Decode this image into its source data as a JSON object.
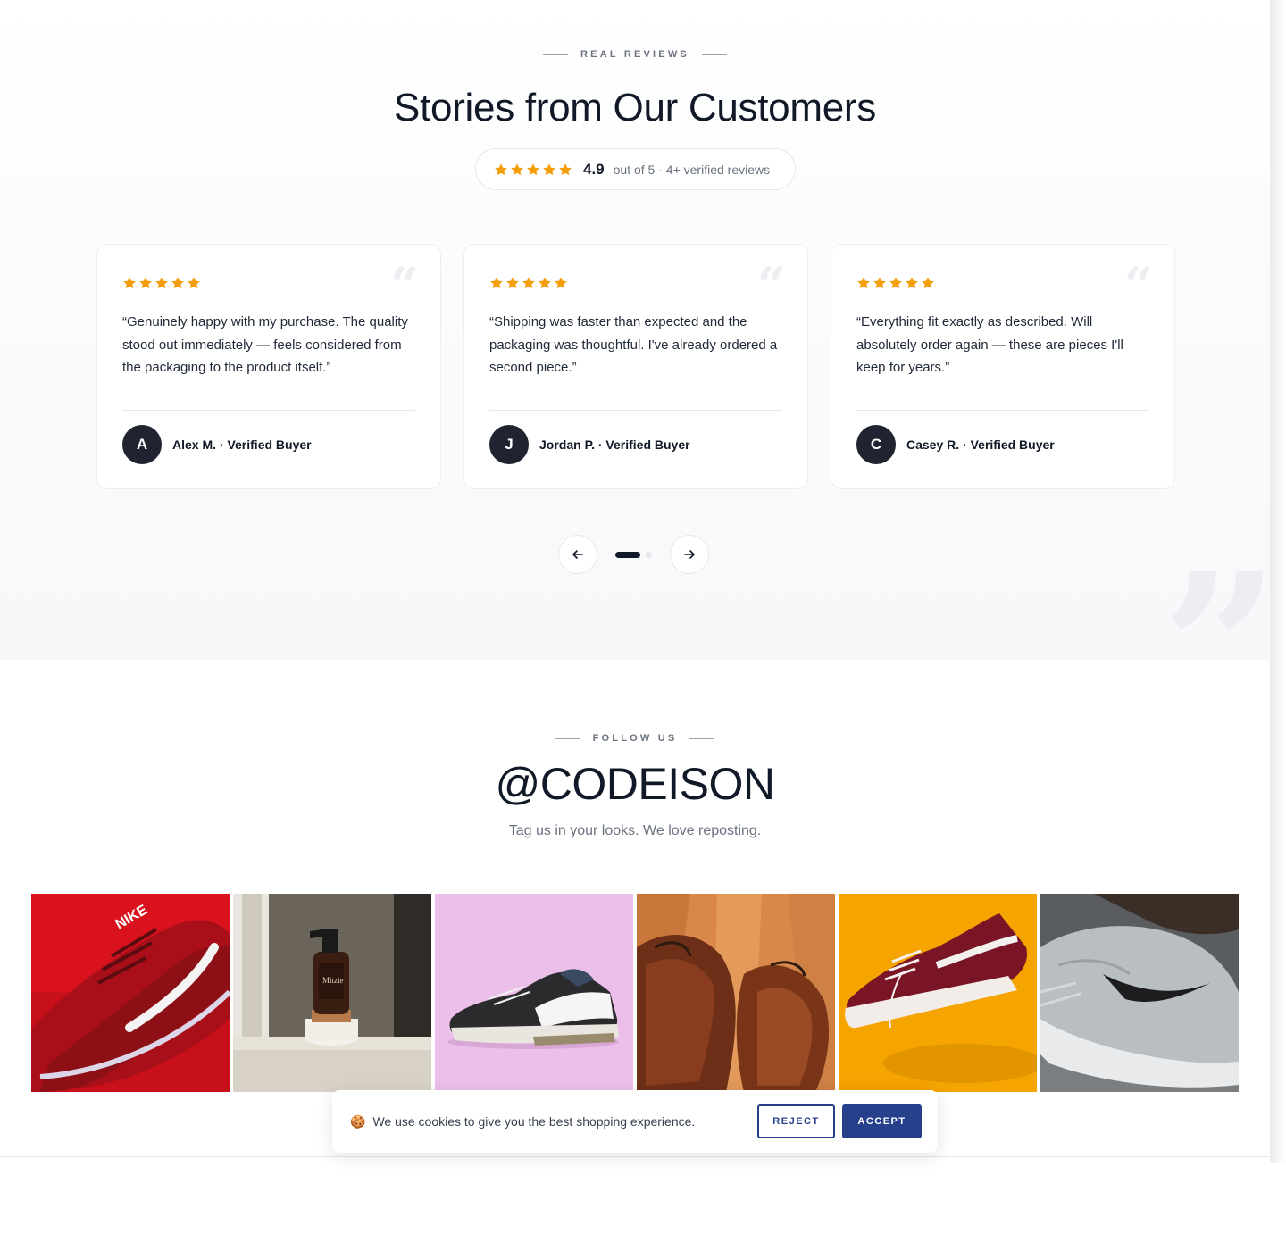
{
  "colors": {
    "star": "#f59e0b",
    "dark": "#111827",
    "avatar_bg": "#1f2430",
    "accent_button": "#27408b"
  },
  "reviews_section": {
    "eyebrow": "REAL REVIEWS",
    "title": "Stories from Our Customers",
    "rating": {
      "stars": 5,
      "score": "4.9",
      "text": "out of 5 · 4+ verified reviews"
    },
    "cards": [
      {
        "stars": 5,
        "quote": "“Genuinely happy with my purchase. The quality stood out immediately — feels considered from the packaging to the product itself.”",
        "avatar_initial": "A",
        "author": "Alex M. · Verified Buyer"
      },
      {
        "stars": 5,
        "quote": "“Shipping was faster than expected and the packaging was thoughtful. I've already ordered a second piece.”",
        "avatar_initial": "J",
        "author": "Jordan P. · Verified Buyer"
      },
      {
        "stars": 5,
        "quote": "“Everything fit exactly as described. Will absolutely order again — these are pieces I'll keep for years.”",
        "avatar_initial": "C",
        "author": "Casey R. · Verified Buyer"
      }
    ],
    "carousel": {
      "prev_icon": "arrow-left-icon",
      "next_icon": "arrow-right-icon",
      "pages": 2,
      "active_page": 1
    }
  },
  "follow_section": {
    "eyebrow": "FOLLOW US",
    "handle": "@CODEISON",
    "subtitle": "Tag us in your looks. We love reposting.",
    "gallery": [
      {
        "subject": "red running sneaker"
      },
      {
        "subject": "amber spray bottle on windowsill"
      },
      {
        "subject": "black and white sneaker on pink"
      },
      {
        "subject": "brown leather shoes on wood floor"
      },
      {
        "subject": "maroon skate shoe on yellow"
      },
      {
        "subject": "grey sneaker on foot"
      }
    ]
  },
  "cookie_banner": {
    "icon": "🍪",
    "text": "We use cookies to give you the best shopping experience.",
    "reject_label": "REJECT",
    "accept_label": "ACCEPT"
  }
}
